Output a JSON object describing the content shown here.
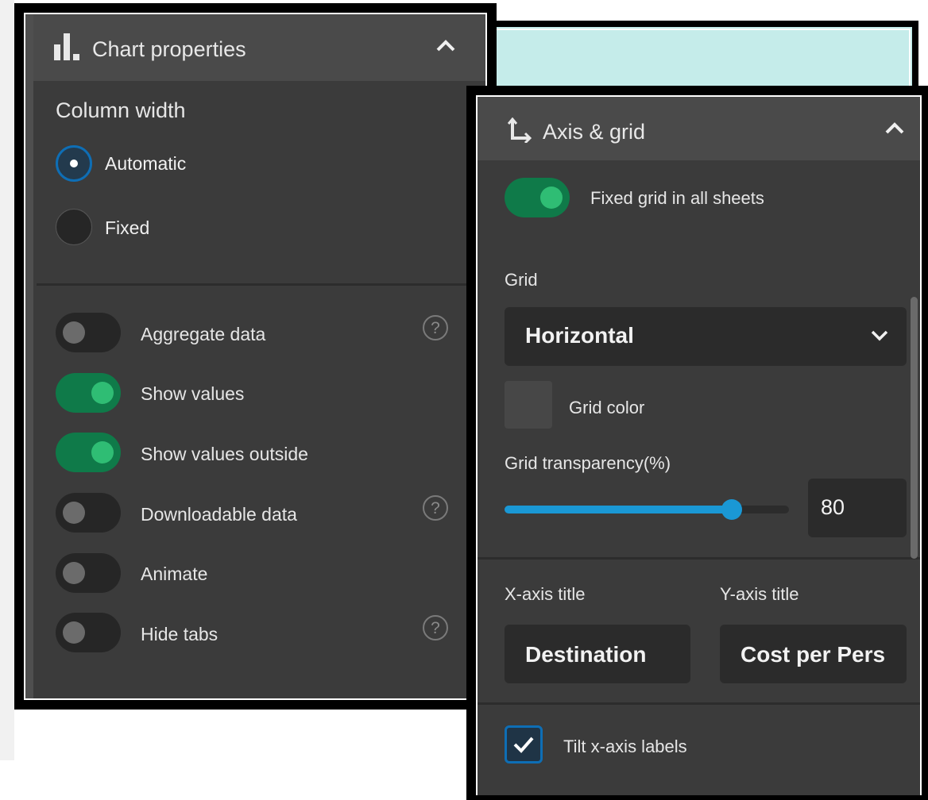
{
  "chart_properties": {
    "title": "Chart properties",
    "header_icon": "bar-chart-icon",
    "collapse_icon": "chevron-up-icon",
    "column_width": {
      "label": "Column width",
      "options": [
        {
          "label": "Automatic",
          "selected": true
        },
        {
          "label": "Fixed",
          "selected": false
        }
      ]
    },
    "toggles": [
      {
        "label": "Aggregate data",
        "on": false,
        "help": "?"
      },
      {
        "label": "Show values",
        "on": true,
        "help": ""
      },
      {
        "label": "Show values outside",
        "on": true,
        "help": ""
      },
      {
        "label": "Downloadable data",
        "on": false,
        "help": "?"
      },
      {
        "label": "Animate",
        "on": false,
        "help": ""
      },
      {
        "label": "Hide tabs",
        "on": false,
        "help": "?"
      }
    ]
  },
  "axis_grid": {
    "title": "Axis & grid",
    "header_icon": "axis-icon",
    "collapse_icon": "chevron-up-icon",
    "fixed_grid": {
      "label": "Fixed grid in all sheets",
      "on": true
    },
    "grid": {
      "label": "Grid",
      "value": "Horizontal"
    },
    "grid_color": {
      "label": "Grid color",
      "value": "#474747"
    },
    "grid_transparency": {
      "label": "Grid transparency(%)",
      "value": "80",
      "fraction": 0.8
    },
    "x_axis_title": {
      "label": "X-axis title",
      "value": "Destination"
    },
    "y_axis_title": {
      "label": "Y-axis title",
      "value": "Cost per Pers"
    },
    "tilt_labels": {
      "label": "Tilt x-axis labels",
      "checked": true
    }
  },
  "colors": {
    "panel_bg": "#3b3b3b",
    "header_bg": "#4a4a4a",
    "toggle_on": "#0f7a49",
    "accent_blue": "#1a98d5",
    "teal_strip": "#c5ecea"
  }
}
